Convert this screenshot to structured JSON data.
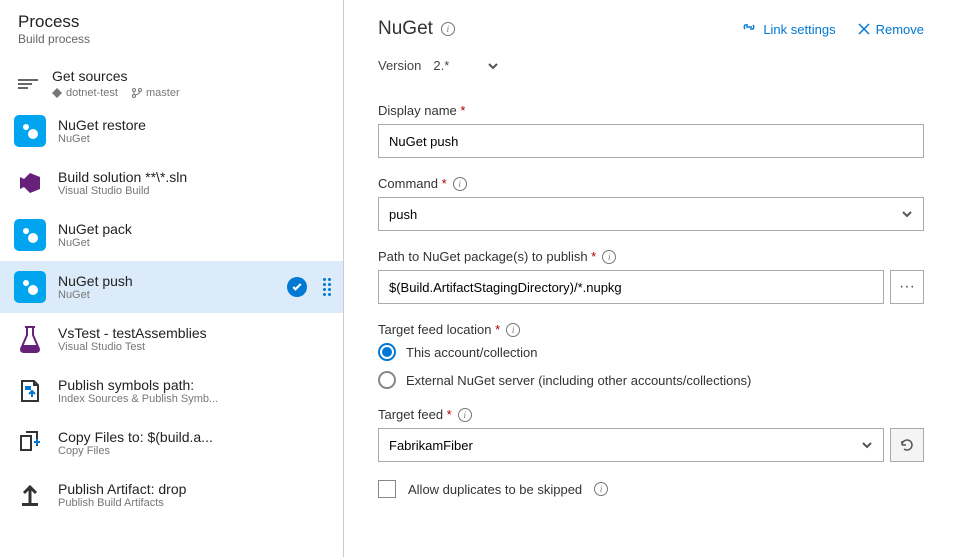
{
  "left": {
    "title": "Process",
    "subtitle": "Build process",
    "get_sources": {
      "label": "Get sources",
      "repo": "dotnet-test",
      "branch": "master"
    },
    "tasks": [
      {
        "title": "NuGet restore",
        "sub": "NuGet",
        "icon": "nuget"
      },
      {
        "title": "Build solution **\\*.sln",
        "sub": "Visual Studio Build",
        "icon": "vs"
      },
      {
        "title": "NuGet pack",
        "sub": "NuGet",
        "icon": "nuget"
      },
      {
        "title": "NuGet push",
        "sub": "NuGet",
        "icon": "nuget",
        "selected": true
      },
      {
        "title": "VsTest - testAssemblies",
        "sub": "Visual Studio Test",
        "icon": "flask"
      },
      {
        "title": "Publish symbols path:",
        "sub": "Index Sources & Publish Symb...",
        "icon": "publish-symbols"
      },
      {
        "title": "Copy Files to: $(build.a...",
        "sub": "Copy Files",
        "icon": "copy"
      },
      {
        "title": "Publish Artifact: drop",
        "sub": "Publish Build Artifacts",
        "icon": "upload"
      }
    ]
  },
  "right": {
    "title": "NuGet",
    "link_settings": "Link settings",
    "remove": "Remove",
    "version_label": "Version",
    "version_value": "2.*",
    "display_name_label": "Display name",
    "display_name_value": "NuGet push",
    "command_label": "Command",
    "command_value": "push",
    "path_label": "Path to NuGet package(s) to publish",
    "path_value": "$(Build.ArtifactStagingDirectory)/*.nupkg",
    "target_loc_label": "Target feed location",
    "target_opt1": "This account/collection",
    "target_opt2": "External NuGet server (including other accounts/collections)",
    "target_feed_label": "Target feed",
    "target_feed_value": "FabrikamFiber",
    "allow_dup": "Allow duplicates to be skipped"
  }
}
